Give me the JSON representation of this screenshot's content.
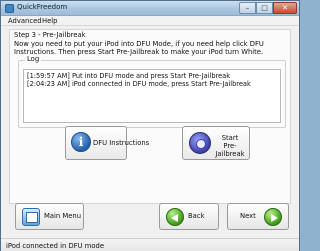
{
  "window": {
    "title": "QuickFreedom",
    "icon": "app-icon",
    "controls": {
      "minimize": "–",
      "maximize": "□",
      "close": "✕"
    }
  },
  "menu": {
    "items": [
      "Advanced",
      "Help"
    ]
  },
  "step": {
    "title": "Step 3 - Pre-Jailbreak",
    "instructions": "Now you need to put your iPod into DFU Mode, if you need help click DFU Instructions. Then press Start Pre-Jailbreak to make your iPod turn White."
  },
  "log": {
    "label": "Log",
    "lines": [
      "[1:59:57 AM] Put into DFU mode and press Start Pre-Jailbreak",
      "[2:04:23 AM] iPod connected in DFU mode, press Start Pre-Jailbreak"
    ]
  },
  "actions": {
    "dfu_instructions": {
      "label": "DFU Instructions",
      "icon": "info-icon"
    },
    "start_prejailbreak": {
      "line1": "Start",
      "line2": "Pre-Jailbreak",
      "icon": "gear-icon"
    }
  },
  "navigation": {
    "main_menu": {
      "label": "Main Menu",
      "icon": "menu-icon"
    },
    "back": {
      "label": "Back",
      "icon": "back-arrow-icon"
    },
    "next": {
      "label": "Next",
      "icon": "next-arrow-icon"
    }
  },
  "status": {
    "text": "iPod connected in DFU mode"
  }
}
